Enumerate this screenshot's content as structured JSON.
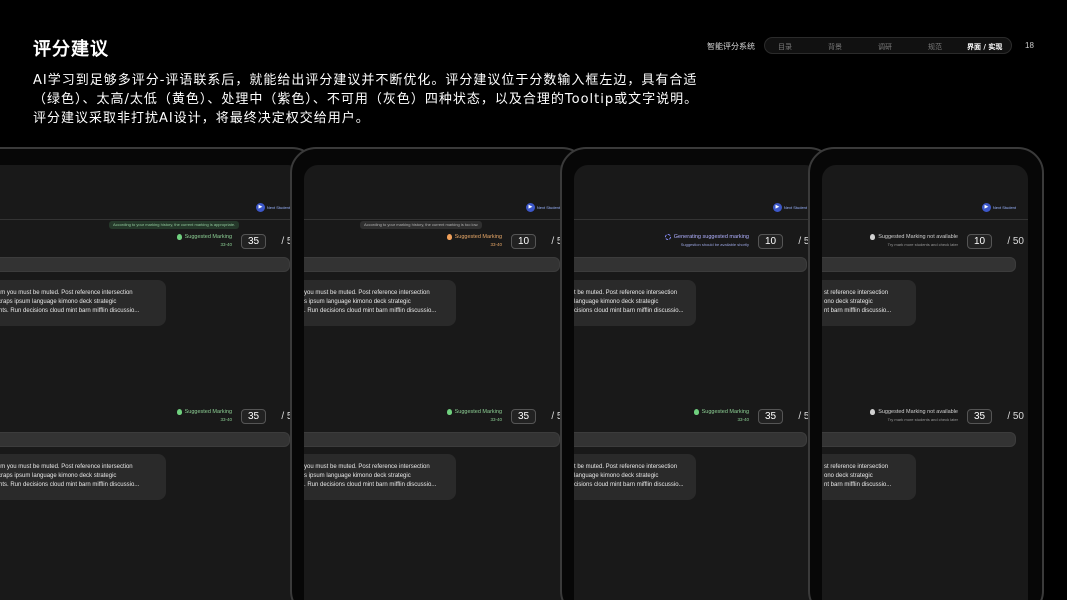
{
  "header": {
    "title": "评分建议",
    "system_name": "智能评分系统",
    "nav": [
      "目录",
      "背景",
      "调研",
      "规范",
      "界面 / 实现"
    ],
    "active_nav": "界面 / 实现",
    "page_number": "18"
  },
  "intro": {
    "lines": [
      "AI学习到足够多评分-评语联系后，就能给出评分建议并不断优化。评分建议位于分数输入框左边，具有合适",
      "（绿色）、太高/太低（黄色）、处理中（紫色）、不可用（灰色）四种状态，以及合理的Tooltip或文字说明。",
      "评分建议采取非打扰AI设计，将最终决定权交给用户。"
    ]
  },
  "common": {
    "next_student": "Next Student",
    "score_total": "/ 50",
    "card_lines": [
      "Office ipsum you must be muted. Post reference intersection",
      "ask we. Scraps ipsum language kimono deck strategic",
      "requirements. Run decisions cloud mint barn mifflin discussio..."
    ],
    "card_lines_cropped": [
      "you must be muted. Post reference intersection",
      "s ipsum language kimono deck strategic",
      ". Run decisions cloud mint barn mifflin discussio..."
    ],
    "card_lines_cropped2": [
      "t be muted. Post reference intersection",
      "language kimono deck strategic",
      "cisions cloud mint barn mifflin discussio..."
    ],
    "card_lines_cropped3": [
      "st reference intersection",
      "ono deck strategic",
      "nt barn mifflin discussio..."
    ]
  },
  "devices": [
    {
      "state": "appropriate",
      "tooltip": "According to your marking history, the current marking is appropriate.",
      "top": {
        "label": "Suggested Marking",
        "range": "33-40",
        "score": "35"
      },
      "bottom": {
        "label": "Suggested Marking",
        "range": "33-40",
        "score": "35"
      }
    },
    {
      "state": "too-low",
      "tooltip": "According to your marking history, the current marking is too low.",
      "top": {
        "label": "Suggested Marking",
        "range": "33-40",
        "score": "10"
      },
      "bottom": {
        "label": "Suggested Marking",
        "range": "33-40",
        "score": "35"
      }
    },
    {
      "state": "processing",
      "top": {
        "label": "Generating suggested marking",
        "range": "Suggestion should be available shortly",
        "score": "10"
      },
      "bottom": {
        "label": "Suggested Marking",
        "range": "33-40",
        "score": "35"
      }
    },
    {
      "state": "unavailable",
      "top": {
        "label": "Suggested Marking not available",
        "range": "Try mark more students and check later",
        "score": "10"
      },
      "bottom": {
        "label": "Suggested Marking not available",
        "range": "Try mark more students and check later",
        "score": "35"
      }
    }
  ],
  "colors": {
    "green": "#8ccf94",
    "yellow": "#e8a868",
    "purple": "#b0b0ff",
    "gray": "#d0d0d0",
    "accent_blue": "#3c57c9"
  }
}
